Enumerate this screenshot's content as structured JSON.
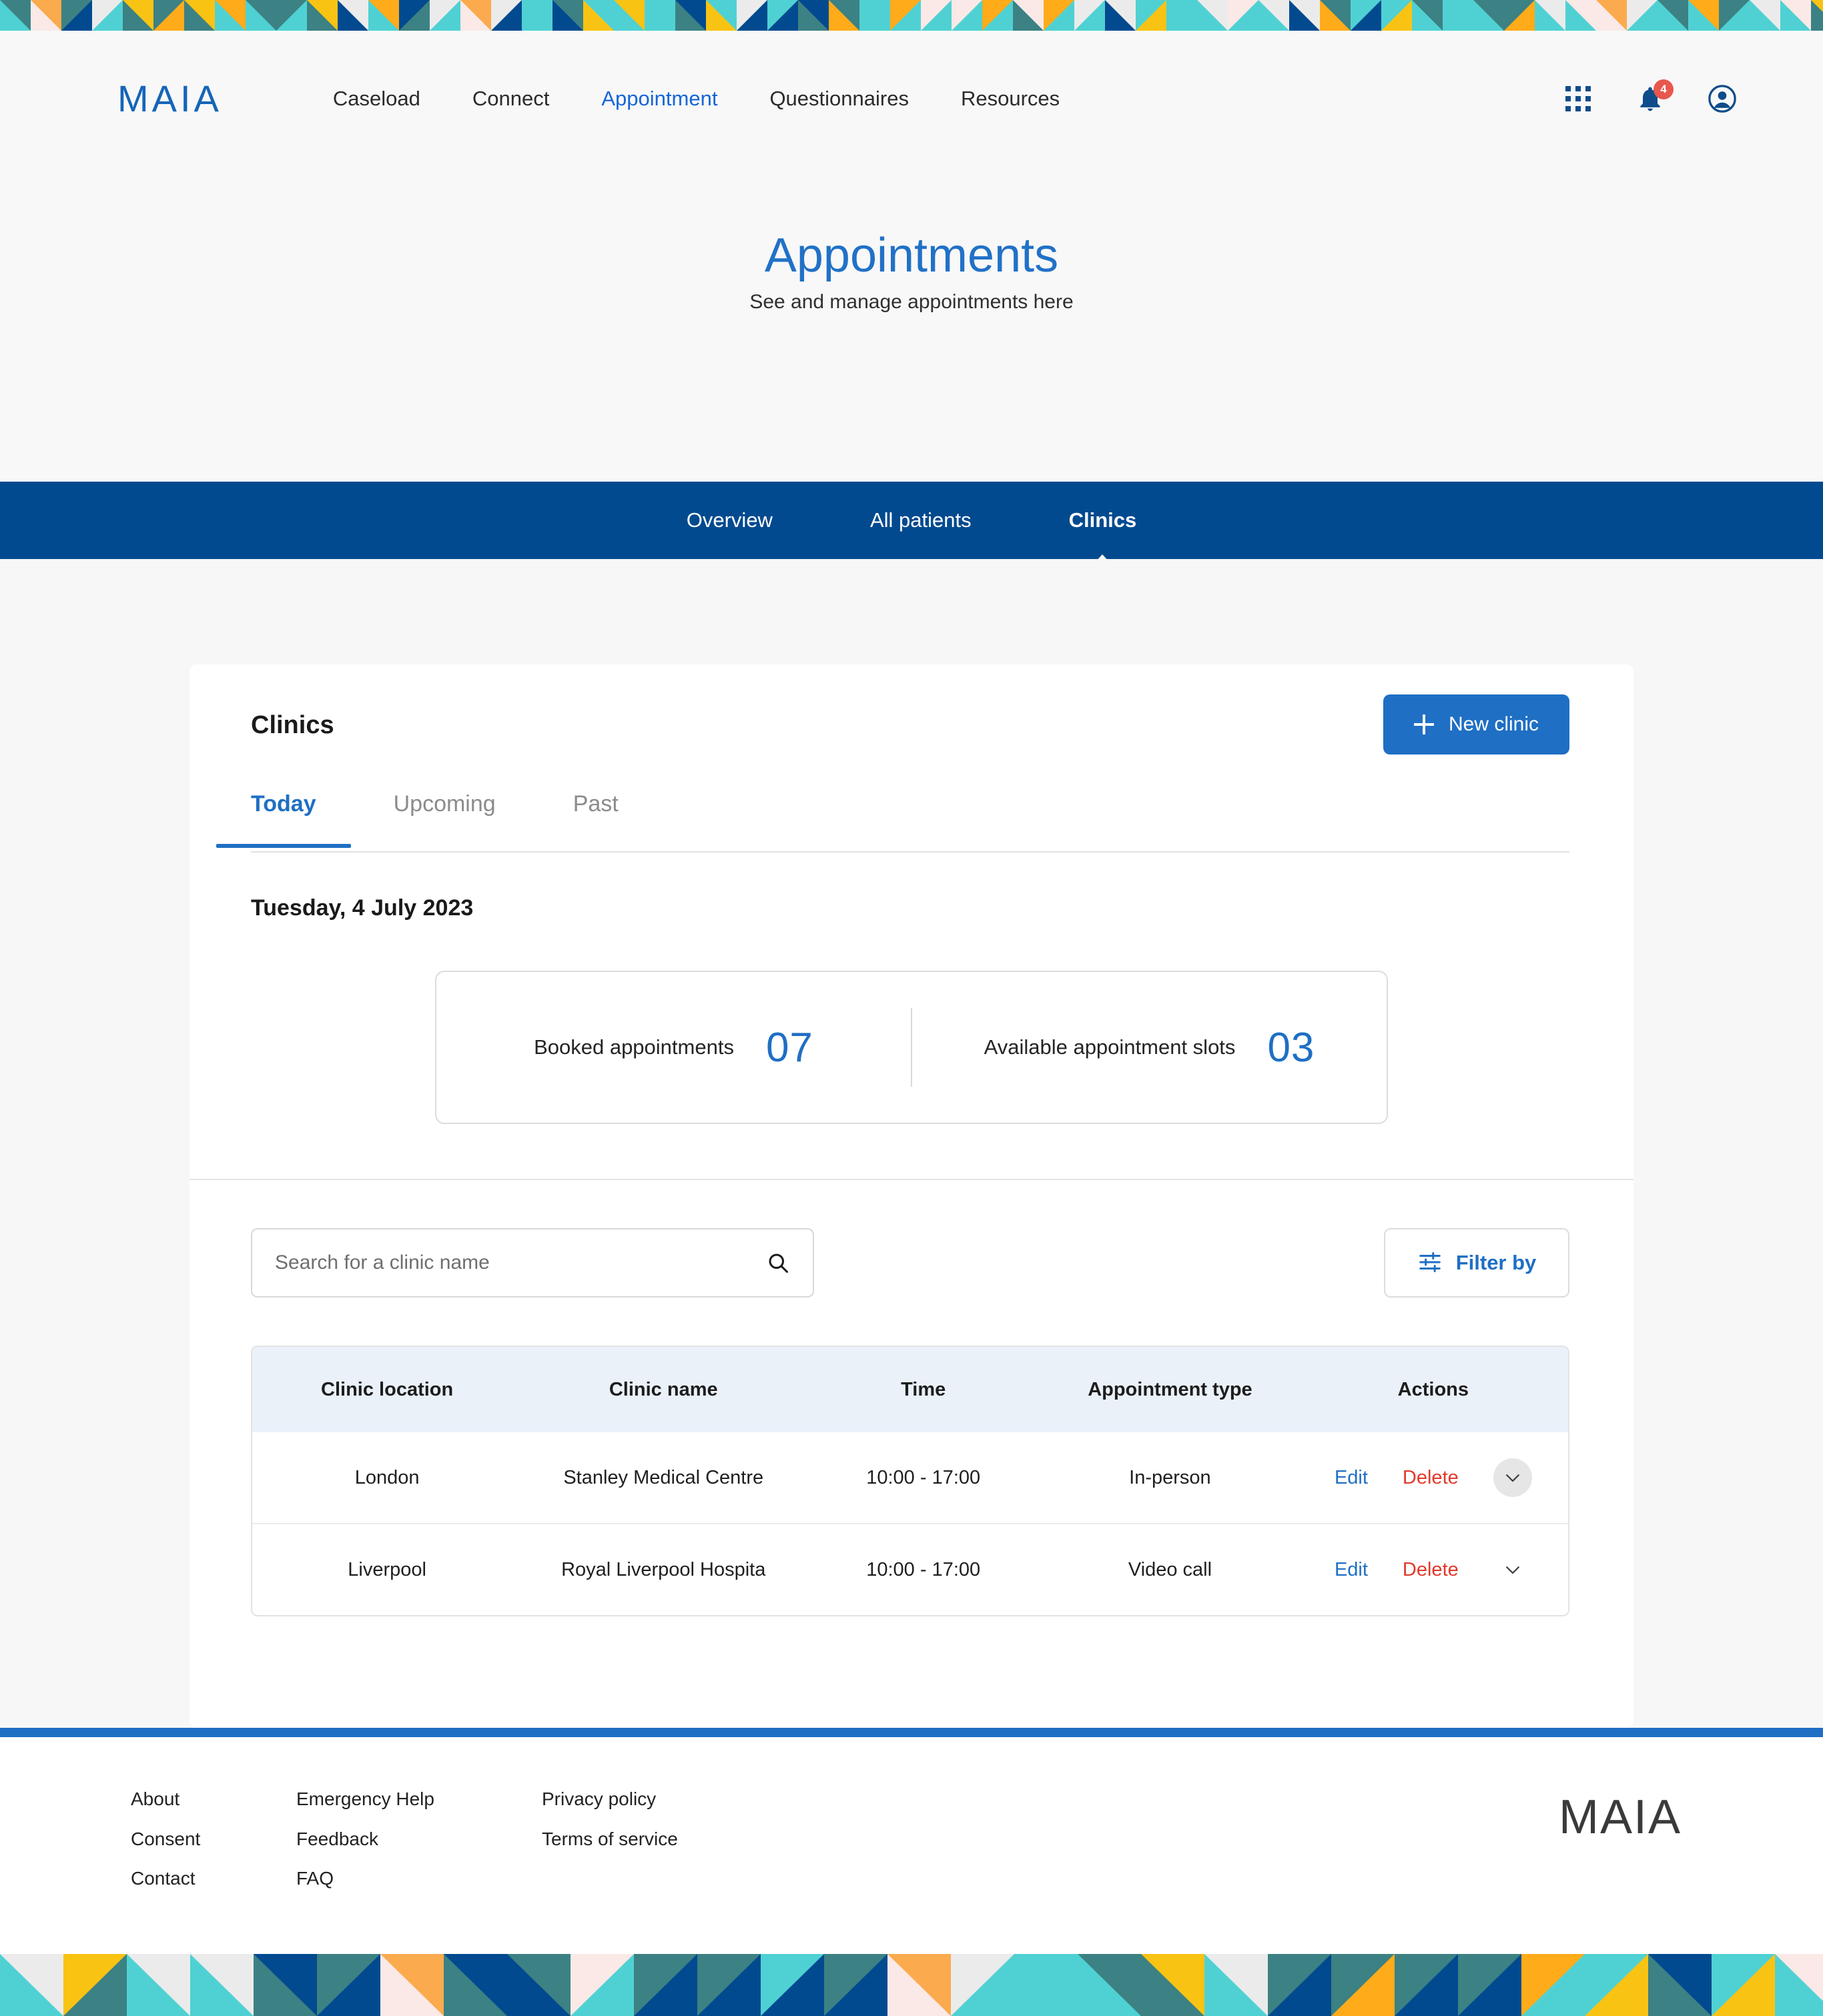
{
  "brand": {
    "name": "MAIA",
    "footer_name": "MAIA"
  },
  "nav": {
    "links": [
      {
        "label": "Caseload",
        "active": false
      },
      {
        "label": "Connect",
        "active": false
      },
      {
        "label": "Appointment",
        "active": true
      },
      {
        "label": "Questionnaires",
        "active": false
      },
      {
        "label": "Resources",
        "active": false
      }
    ],
    "icons": {
      "apps": "apps-grid-icon",
      "notifications": "bell-icon",
      "notification_count": "4",
      "account": "account-circle-icon"
    }
  },
  "hero": {
    "title": "Appointments",
    "subtitle": "See and manage appointments here"
  },
  "section_tabs": [
    {
      "label": "Overview",
      "active": false
    },
    {
      "label": "All patients",
      "active": false
    },
    {
      "label": "Clinics",
      "active": true
    }
  ],
  "card": {
    "title": "Clinics",
    "new_clinic_label": "New clinic",
    "subtabs": [
      {
        "label": "Today",
        "active": true
      },
      {
        "label": "Upcoming",
        "active": false
      },
      {
        "label": "Past",
        "active": false
      }
    ],
    "date": "Tuesday, 4 July 2023",
    "stats": [
      {
        "label": "Booked appointments",
        "value": "07"
      },
      {
        "label": "Available appointment slots",
        "value": "03"
      }
    ],
    "search": {
      "placeholder": "Search for a clinic name",
      "value": ""
    },
    "filter_label": "Filter by",
    "table": {
      "headers": [
        "Clinic location",
        "Clinic name",
        "Time",
        "Appointment type",
        "Actions"
      ],
      "rows": [
        {
          "location": "London",
          "name": "Stanley Medical Centre",
          "time": "10:00 - 17:00",
          "type": "In-person",
          "edit": "Edit",
          "delete": "Delete",
          "expanded_hover": true
        },
        {
          "location": "Liverpool",
          "name": "Royal Liverpool Hospita",
          "time": "10:00 - 17:00",
          "type": "Video call",
          "edit": "Edit",
          "delete": "Delete",
          "expanded_hover": false
        }
      ]
    }
  },
  "footer": {
    "columns": [
      {
        "links": [
          "About",
          "Consent",
          "Contact"
        ]
      },
      {
        "links": [
          "Emergency Help",
          "Feedback",
          "FAQ"
        ]
      },
      {
        "links": [
          "Privacy policy",
          "Terms of service"
        ]
      }
    ]
  },
  "colors": {
    "primary_blue": "#1f6fc4",
    "dark_blue": "#024a8f",
    "title_blue": "#2171c7",
    "delete_red": "#e1392b",
    "badge_red": "#e8574d",
    "pattern": [
      "#f9c313",
      "#4fd1d3",
      "#3c8183",
      "#024a8f",
      "#fae9e7",
      "#ebebeb",
      "#fbaa4d",
      "#ffab1a"
    ]
  }
}
